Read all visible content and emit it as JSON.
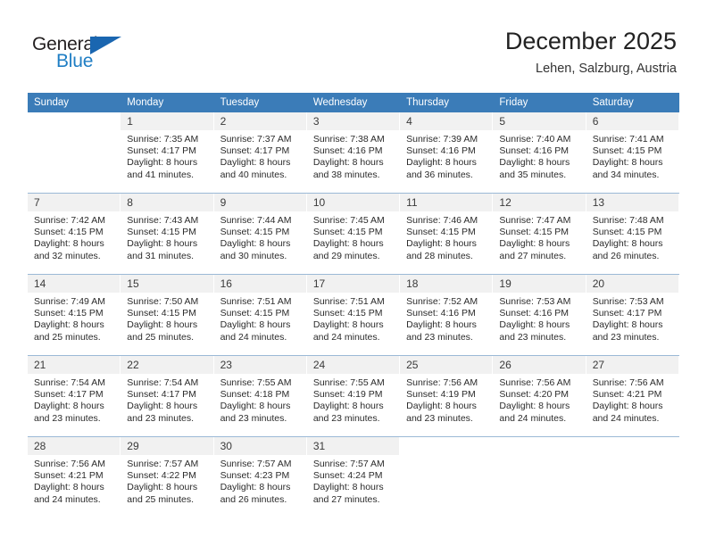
{
  "logo": {
    "word_top": "General",
    "word_bottom": "Blue",
    "color_dark": "#231f20",
    "color_blue": "#1f7ec4",
    "triangle_color": "#1a66b0"
  },
  "header": {
    "title": "December 2025",
    "subtitle": "Lehen, Salzburg, Austria"
  },
  "theme": {
    "header_row_bg": "#3b7cb8",
    "daynum_bg": "#f1f1f1",
    "row_divider": "#9bb9d6"
  },
  "weekday_headers": [
    "Sunday",
    "Monday",
    "Tuesday",
    "Wednesday",
    "Thursday",
    "Friday",
    "Saturday"
  ],
  "weeks": [
    [
      {
        "day": "",
        "blank": true,
        "sunrise": "",
        "sunset": "",
        "daylight_line1": "",
        "daylight_line2": ""
      },
      {
        "day": "1",
        "sunrise": "Sunrise: 7:35 AM",
        "sunset": "Sunset: 4:17 PM",
        "daylight_line1": "Daylight: 8 hours",
        "daylight_line2": "and 41 minutes."
      },
      {
        "day": "2",
        "sunrise": "Sunrise: 7:37 AM",
        "sunset": "Sunset: 4:17 PM",
        "daylight_line1": "Daylight: 8 hours",
        "daylight_line2": "and 40 minutes."
      },
      {
        "day": "3",
        "sunrise": "Sunrise: 7:38 AM",
        "sunset": "Sunset: 4:16 PM",
        "daylight_line1": "Daylight: 8 hours",
        "daylight_line2": "and 38 minutes."
      },
      {
        "day": "4",
        "sunrise": "Sunrise: 7:39 AM",
        "sunset": "Sunset: 4:16 PM",
        "daylight_line1": "Daylight: 8 hours",
        "daylight_line2": "and 36 minutes."
      },
      {
        "day": "5",
        "sunrise": "Sunrise: 7:40 AM",
        "sunset": "Sunset: 4:16 PM",
        "daylight_line1": "Daylight: 8 hours",
        "daylight_line2": "and 35 minutes."
      },
      {
        "day": "6",
        "sunrise": "Sunrise: 7:41 AM",
        "sunset": "Sunset: 4:15 PM",
        "daylight_line1": "Daylight: 8 hours",
        "daylight_line2": "and 34 minutes."
      }
    ],
    [
      {
        "day": "7",
        "sunrise": "Sunrise: 7:42 AM",
        "sunset": "Sunset: 4:15 PM",
        "daylight_line1": "Daylight: 8 hours",
        "daylight_line2": "and 32 minutes."
      },
      {
        "day": "8",
        "sunrise": "Sunrise: 7:43 AM",
        "sunset": "Sunset: 4:15 PM",
        "daylight_line1": "Daylight: 8 hours",
        "daylight_line2": "and 31 minutes."
      },
      {
        "day": "9",
        "sunrise": "Sunrise: 7:44 AM",
        "sunset": "Sunset: 4:15 PM",
        "daylight_line1": "Daylight: 8 hours",
        "daylight_line2": "and 30 minutes."
      },
      {
        "day": "10",
        "sunrise": "Sunrise: 7:45 AM",
        "sunset": "Sunset: 4:15 PM",
        "daylight_line1": "Daylight: 8 hours",
        "daylight_line2": "and 29 minutes."
      },
      {
        "day": "11",
        "sunrise": "Sunrise: 7:46 AM",
        "sunset": "Sunset: 4:15 PM",
        "daylight_line1": "Daylight: 8 hours",
        "daylight_line2": "and 28 minutes."
      },
      {
        "day": "12",
        "sunrise": "Sunrise: 7:47 AM",
        "sunset": "Sunset: 4:15 PM",
        "daylight_line1": "Daylight: 8 hours",
        "daylight_line2": "and 27 minutes."
      },
      {
        "day": "13",
        "sunrise": "Sunrise: 7:48 AM",
        "sunset": "Sunset: 4:15 PM",
        "daylight_line1": "Daylight: 8 hours",
        "daylight_line2": "and 26 minutes."
      }
    ],
    [
      {
        "day": "14",
        "sunrise": "Sunrise: 7:49 AM",
        "sunset": "Sunset: 4:15 PM",
        "daylight_line1": "Daylight: 8 hours",
        "daylight_line2": "and 25 minutes."
      },
      {
        "day": "15",
        "sunrise": "Sunrise: 7:50 AM",
        "sunset": "Sunset: 4:15 PM",
        "daylight_line1": "Daylight: 8 hours",
        "daylight_line2": "and 25 minutes."
      },
      {
        "day": "16",
        "sunrise": "Sunrise: 7:51 AM",
        "sunset": "Sunset: 4:15 PM",
        "daylight_line1": "Daylight: 8 hours",
        "daylight_line2": "and 24 minutes."
      },
      {
        "day": "17",
        "sunrise": "Sunrise: 7:51 AM",
        "sunset": "Sunset: 4:15 PM",
        "daylight_line1": "Daylight: 8 hours",
        "daylight_line2": "and 24 minutes."
      },
      {
        "day": "18",
        "sunrise": "Sunrise: 7:52 AM",
        "sunset": "Sunset: 4:16 PM",
        "daylight_line1": "Daylight: 8 hours",
        "daylight_line2": "and 23 minutes."
      },
      {
        "day": "19",
        "sunrise": "Sunrise: 7:53 AM",
        "sunset": "Sunset: 4:16 PM",
        "daylight_line1": "Daylight: 8 hours",
        "daylight_line2": "and 23 minutes."
      },
      {
        "day": "20",
        "sunrise": "Sunrise: 7:53 AM",
        "sunset": "Sunset: 4:17 PM",
        "daylight_line1": "Daylight: 8 hours",
        "daylight_line2": "and 23 minutes."
      }
    ],
    [
      {
        "day": "21",
        "sunrise": "Sunrise: 7:54 AM",
        "sunset": "Sunset: 4:17 PM",
        "daylight_line1": "Daylight: 8 hours",
        "daylight_line2": "and 23 minutes."
      },
      {
        "day": "22",
        "sunrise": "Sunrise: 7:54 AM",
        "sunset": "Sunset: 4:17 PM",
        "daylight_line1": "Daylight: 8 hours",
        "daylight_line2": "and 23 minutes."
      },
      {
        "day": "23",
        "sunrise": "Sunrise: 7:55 AM",
        "sunset": "Sunset: 4:18 PM",
        "daylight_line1": "Daylight: 8 hours",
        "daylight_line2": "and 23 minutes."
      },
      {
        "day": "24",
        "sunrise": "Sunrise: 7:55 AM",
        "sunset": "Sunset: 4:19 PM",
        "daylight_line1": "Daylight: 8 hours",
        "daylight_line2": "and 23 minutes."
      },
      {
        "day": "25",
        "sunrise": "Sunrise: 7:56 AM",
        "sunset": "Sunset: 4:19 PM",
        "daylight_line1": "Daylight: 8 hours",
        "daylight_line2": "and 23 minutes."
      },
      {
        "day": "26",
        "sunrise": "Sunrise: 7:56 AM",
        "sunset": "Sunset: 4:20 PM",
        "daylight_line1": "Daylight: 8 hours",
        "daylight_line2": "and 24 minutes."
      },
      {
        "day": "27",
        "sunrise": "Sunrise: 7:56 AM",
        "sunset": "Sunset: 4:21 PM",
        "daylight_line1": "Daylight: 8 hours",
        "daylight_line2": "and 24 minutes."
      }
    ],
    [
      {
        "day": "28",
        "sunrise": "Sunrise: 7:56 AM",
        "sunset": "Sunset: 4:21 PM",
        "daylight_line1": "Daylight: 8 hours",
        "daylight_line2": "and 24 minutes."
      },
      {
        "day": "29",
        "sunrise": "Sunrise: 7:57 AM",
        "sunset": "Sunset: 4:22 PM",
        "daylight_line1": "Daylight: 8 hours",
        "daylight_line2": "and 25 minutes."
      },
      {
        "day": "30",
        "sunrise": "Sunrise: 7:57 AM",
        "sunset": "Sunset: 4:23 PM",
        "daylight_line1": "Daylight: 8 hours",
        "daylight_line2": "and 26 minutes."
      },
      {
        "day": "31",
        "sunrise": "Sunrise: 7:57 AM",
        "sunset": "Sunset: 4:24 PM",
        "daylight_line1": "Daylight: 8 hours",
        "daylight_line2": "and 27 minutes."
      },
      {
        "day": "",
        "blank": true,
        "sunrise": "",
        "sunset": "",
        "daylight_line1": "",
        "daylight_line2": ""
      },
      {
        "day": "",
        "blank": true,
        "sunrise": "",
        "sunset": "",
        "daylight_line1": "",
        "daylight_line2": ""
      },
      {
        "day": "",
        "blank": true,
        "sunrise": "",
        "sunset": "",
        "daylight_line1": "",
        "daylight_line2": ""
      }
    ]
  ]
}
